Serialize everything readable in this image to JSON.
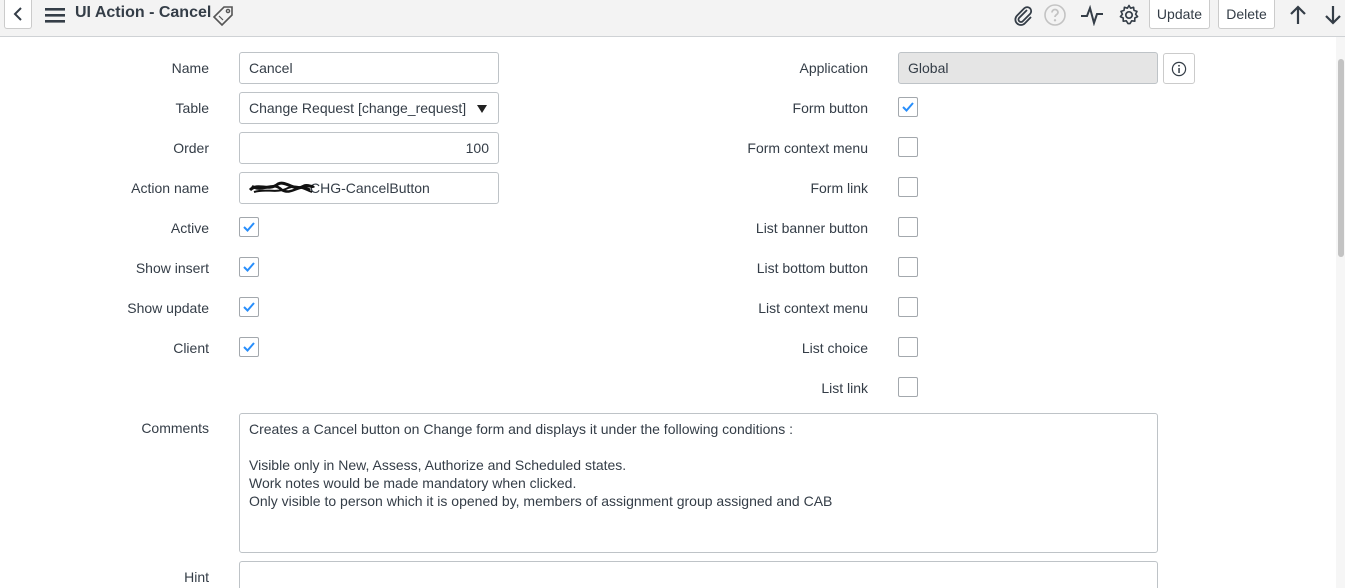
{
  "header": {
    "title": "UI Action - Cancel",
    "update_label": "Update",
    "delete_label": "Delete"
  },
  "form": {
    "name": {
      "label": "Name",
      "value": "Cancel"
    },
    "table": {
      "label": "Table",
      "value": "Change Request [change_request]"
    },
    "order": {
      "label": "Order",
      "value": "100"
    },
    "action_name": {
      "label": "Action name",
      "value": "CHG-CancelButton"
    },
    "active": {
      "label": "Active",
      "checked": true
    },
    "show_insert": {
      "label": "Show insert",
      "checked": true
    },
    "show_update": {
      "label": "Show update",
      "checked": true
    },
    "client": {
      "label": "Client",
      "checked": true
    },
    "application": {
      "label": "Application",
      "value": "Global"
    },
    "form_button": {
      "label": "Form button",
      "checked": true
    },
    "form_context_menu": {
      "label": "Form context menu",
      "checked": false
    },
    "form_link": {
      "label": "Form link",
      "checked": false
    },
    "list_banner_button": {
      "label": "List banner button",
      "checked": false
    },
    "list_bottom_button": {
      "label": "List bottom button",
      "checked": false
    },
    "list_context_menu": {
      "label": "List context menu",
      "checked": false
    },
    "list_choice": {
      "label": "List choice",
      "checked": false
    },
    "list_link": {
      "label": "List link",
      "checked": false
    },
    "comments": {
      "label": "Comments",
      "line1": "Creates a Cancel button on Change form and displays it under the following conditions :",
      "line2": "Visible only in New, Assess, Authorize and Scheduled states.",
      "line3": "Work notes would be made mandatory when clicked.",
      "line4": "Only visible to person which it is opened by, members of assignment group assigned and CAB"
    },
    "hint": {
      "label": "Hint",
      "value": ""
    }
  },
  "colors": {
    "accent": "#278efc",
    "header_bg": "#f3f3f3",
    "readonly_bg": "#e5e5e5"
  }
}
